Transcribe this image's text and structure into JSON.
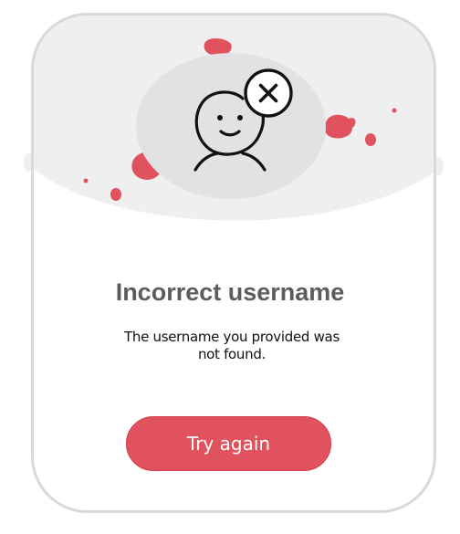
{
  "dialog": {
    "title": "Incorrect username",
    "message": "The username you provided was not found.",
    "button_label": "Try again"
  },
  "icons": {
    "illustration": "user-with-x-icon"
  },
  "colors": {
    "accent": "#e0535e",
    "title_text": "#5c5c5c",
    "hero_bg": "#efefef",
    "avatar_circle": "#e2e2e2",
    "card_border": "#d9d9d9"
  }
}
